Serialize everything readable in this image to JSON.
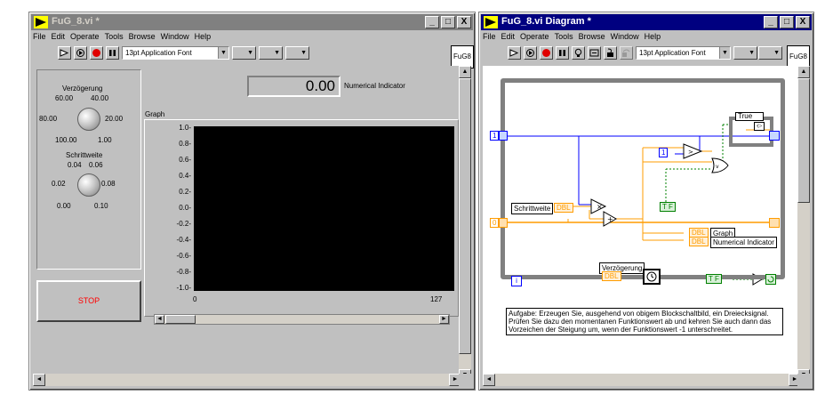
{
  "front_panel": {
    "title": "FuG_8.vi *",
    "window_buttons": [
      "_",
      "□",
      "X"
    ],
    "menu": [
      "File",
      "Edit",
      "Operate",
      "Tools",
      "Browse",
      "Window",
      "Help"
    ],
    "font_selector": "13pt Application Font",
    "vi_icon_text": "FuG8",
    "knob1": {
      "label": "Verzögerung",
      "scale": [
        "60.00",
        "40.00",
        "80.00",
        "20.00",
        "100.00",
        "1.00"
      ]
    },
    "knob2": {
      "label": "Schrittweite",
      "scale": [
        "0.04",
        "0.06",
        "0.02",
        "0.08",
        "0.00",
        "0.10"
      ]
    },
    "stop_button": "STOP",
    "numeric_indicator": {
      "value": "0.00",
      "label": "Numerical Indicator"
    },
    "graph": {
      "label": "Graph",
      "y_ticks": [
        "1.0-",
        "0.8-",
        "0.6-",
        "0.4-",
        "0.2-",
        "0.0-",
        "-0.2-",
        "-0.4-",
        "-0.6-",
        "-0.8-",
        "-1.0-"
      ],
      "x_min": "0",
      "x_max": "127"
    }
  },
  "diagram": {
    "title": "FuG_8.vi Diagram *",
    "window_buttons": [
      "_",
      "□",
      "X"
    ],
    "menu": [
      "File",
      "Edit",
      "Operate",
      "Tools",
      "Browse",
      "Window",
      "Help"
    ],
    "font_selector": "13pt Application Font",
    "vi_icon_text": "FuG8",
    "case_label": "True",
    "const_one_left": "1",
    "const_zero_left": "0",
    "const_one_inner": "1",
    "schrittweite_label": "Schrittweite",
    "dbl_tag": "DBL",
    "tf_tag": "T F",
    "graph_terminal": "Graph",
    "numind_terminal": "Numerical Indicator",
    "verzoegerung_label": "Verzögerung",
    "loop_index": "i",
    "tf_const": "T F",
    "description": "Aufgabe: Erzeugen Sie, ausgehend von obigem Blockschaltbild, ein Dreiecksignal. Prüfen Sie dazu den momentanen Funktionswert ab und kehren Sie auch dann das Vorzeichen der Steigung um, wenn der Funktionswert -1 unterschreitet."
  },
  "colors": {
    "title_active": "#000080",
    "title_inactive": "#808080",
    "plot_bg": "#000000",
    "stop_text": "#ff0000",
    "wire_orange": "#ff9c00",
    "wire_blue": "#0000ff",
    "wire_green": "#008000"
  }
}
